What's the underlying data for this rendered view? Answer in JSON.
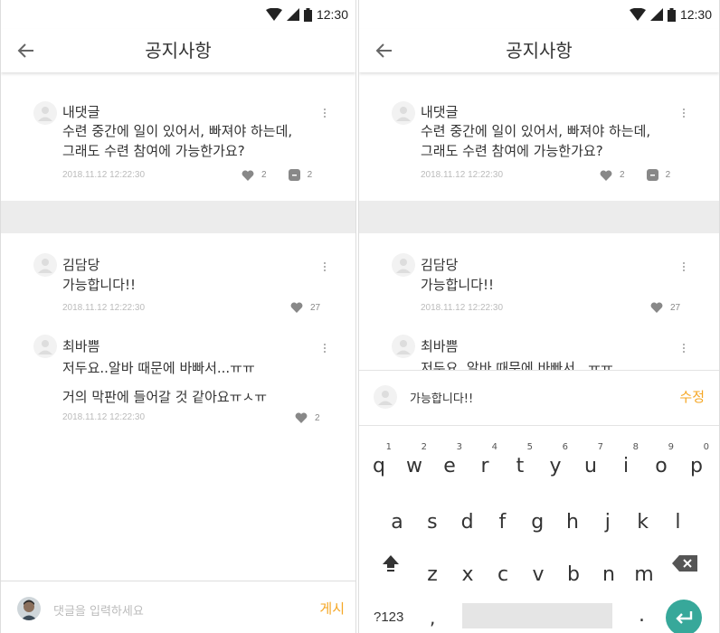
{
  "status": {
    "time": "12:30"
  },
  "appbar": {
    "title": "공지사항"
  },
  "post": {
    "author": "내댓글",
    "line1": "수련 중간에 일이 있어서, 빠져야 하는데,",
    "line2": "그래도 수련 참여에 가능한가요?",
    "date": "2018.11.12 12:22:30",
    "likes": "2",
    "comments": "2"
  },
  "replies": [
    {
      "author": "김담당",
      "text": "가능합니다!!",
      "date": "2018.11.12 12:22:30",
      "likes": "27"
    },
    {
      "author": "최바쁨",
      "text1": "저두요..알바 때문에 바빠서...ㅠㅠ",
      "text2": "거의 막판에 들어갈 것 같아요ㅠㅅㅠ",
      "date": "2018.11.12 12:22:30",
      "likes": "2"
    }
  ],
  "comment_input": {
    "placeholder": "댓글을 입력하세요",
    "post_label": "게시"
  },
  "edit_input": {
    "value": "가능합니다!!",
    "edit_label": "수정"
  },
  "keyboard": {
    "row1": [
      "q",
      "w",
      "e",
      "r",
      "t",
      "y",
      "u",
      "i",
      "o",
      "p"
    ],
    "row1_nums": [
      "1",
      "2",
      "3",
      "4",
      "5",
      "6",
      "7",
      "8",
      "9",
      "0"
    ],
    "row2": [
      "a",
      "s",
      "d",
      "f",
      "g",
      "h",
      "j",
      "k",
      "l"
    ],
    "row3": [
      "z",
      "x",
      "c",
      "v",
      "b",
      "n",
      "m"
    ],
    "symbols_label": "?123",
    "comma": ",",
    "period": "."
  },
  "colors": {
    "accent": "#f5a623",
    "enter": "#37a89a",
    "divider": "#ececec"
  }
}
